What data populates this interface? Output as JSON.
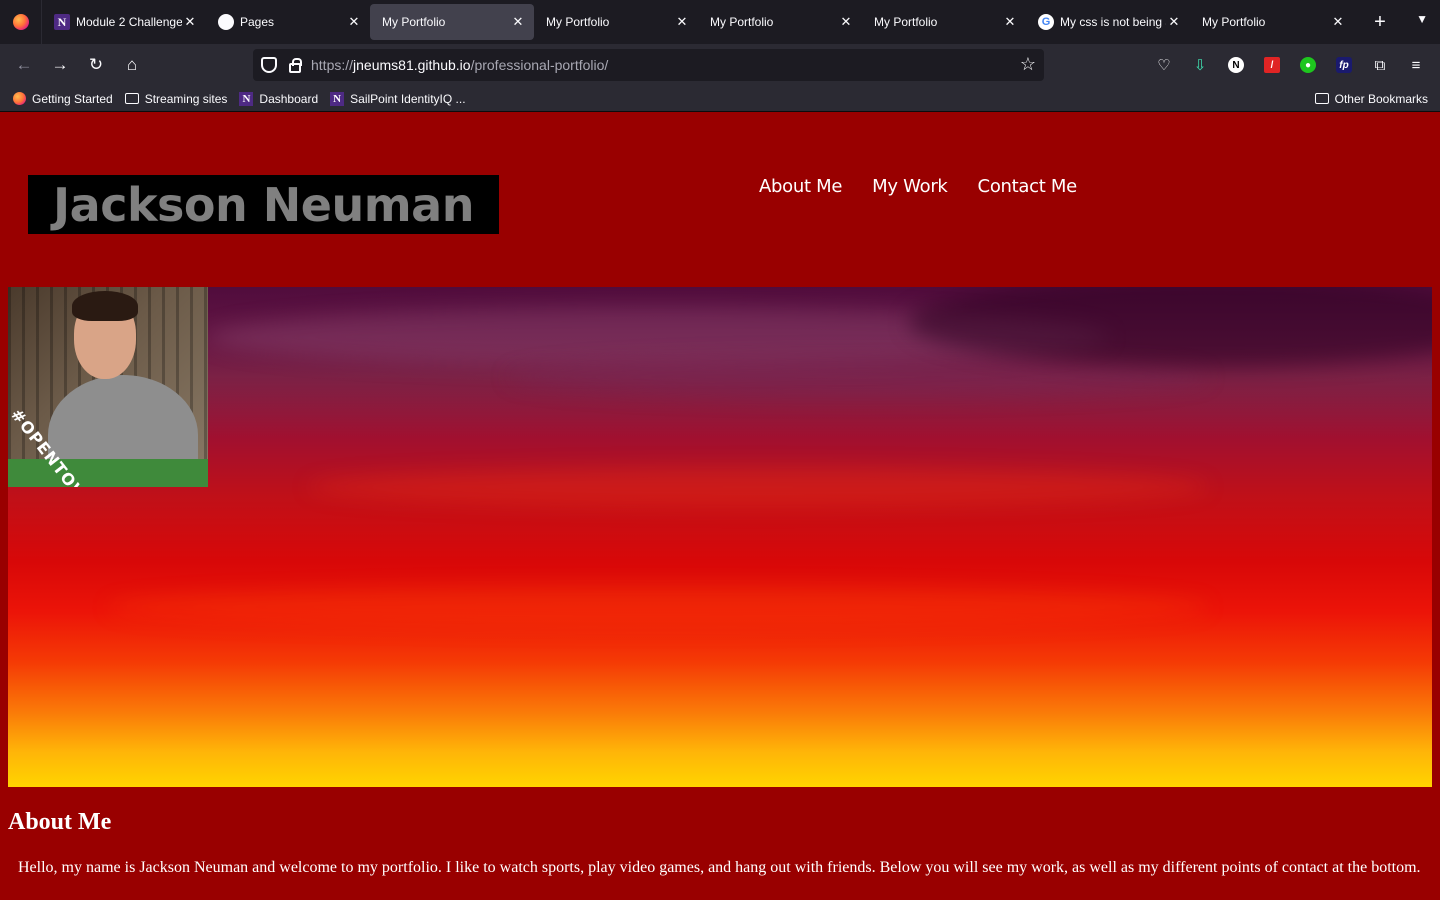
{
  "browser": {
    "tabs": [
      {
        "title": "Module 2 Challenge",
        "icon": "northwestern-icon",
        "active": false
      },
      {
        "title": "Pages",
        "icon": "github-icon",
        "active": false
      },
      {
        "title": "My Portfolio",
        "icon": "",
        "active": true
      },
      {
        "title": "My Portfolio",
        "icon": "",
        "active": false
      },
      {
        "title": "My Portfolio",
        "icon": "",
        "active": false
      },
      {
        "title": "My Portfolio",
        "icon": "",
        "active": false
      },
      {
        "title": "My css is not being a",
        "icon": "google-icon",
        "active": false
      },
      {
        "title": "My Portfolio",
        "icon": "",
        "active": false
      }
    ],
    "url_prefix": "https://",
    "url_host": "jneums81.github.io",
    "url_path": "/professional-portfolio/",
    "bookmarks": [
      {
        "label": "Getting Started",
        "icon": "firefox-icon"
      },
      {
        "label": "Streaming sites",
        "icon": "folder-icon"
      },
      {
        "label": "Dashboard",
        "icon": "northwestern-icon"
      },
      {
        "label": "SailPoint IdentityIQ ...",
        "icon": "northwestern-icon"
      }
    ],
    "other_bookmarks": "Other Bookmarks"
  },
  "site": {
    "name": "Jackson Neuman",
    "nav": [
      "About Me",
      "My Work",
      "Contact Me"
    ],
    "badge_text": "#OPENTOWORK",
    "about_title": "About Me",
    "about_text": "Hello, my name is Jackson Neuman and welcome to my portfolio. I like to watch sports, play video games, and hang out with friends. Below you will see my work, as well as my different points of contact at the bottom."
  },
  "colors": {
    "page_bg": "#990000",
    "name_box_bg": "#000000",
    "name_text": "#808080",
    "badge_green": "#3f8a3b"
  }
}
